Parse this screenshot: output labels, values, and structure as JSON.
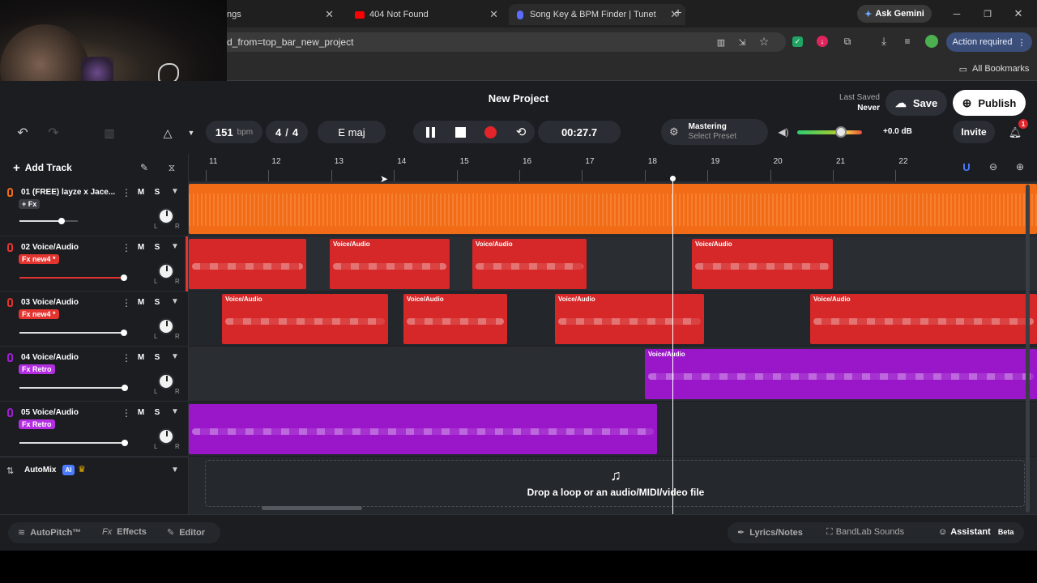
{
  "browser": {
    "tabs": [
      {
        "title": "ngs"
      },
      {
        "title": "404 Not Found"
      },
      {
        "title": "Song Key & BPM Finder | Tunet"
      }
    ],
    "ask_gemini": "Ask Gemini",
    "url": "d_from=top_bar_new_project",
    "action_required": "Action required",
    "all_bookmarks": "All Bookmarks"
  },
  "header": {
    "project_title": "New Project",
    "last_saved_label": "Last Saved",
    "last_saved_value": "Never",
    "save_label": "Save",
    "publish_label": "Publish",
    "bpm_value": "151",
    "bpm_unit": "bpm",
    "time_sig_num": "4",
    "time_sig_den": "4",
    "key": "E maj",
    "time_display": "00:27.7",
    "mastering_label": "Mastering",
    "mastering_preset": "Select Preset",
    "db_value": "+0.0 dB",
    "invite_label": "Invite",
    "notification_count": "1",
    "master_volume": 0.68
  },
  "tracks_panel": {
    "add_track_label": "Add Track",
    "automix_label": "AutoMix",
    "ai_badge": "AI"
  },
  "tracks": [
    {
      "name": "01  (FREE) layze x Jace...",
      "fx": "+ Fx",
      "fx_color": "#3a3d44",
      "color": "#f26b16",
      "volume": 0.72
    },
    {
      "name": "02  Voice/Audio",
      "fx": "Fx new4 *",
      "fx_color": "#e3342f",
      "color": "#e3342f",
      "volume": 0.99
    },
    {
      "name": "03  Voice/Audio",
      "fx": "Fx new4 *",
      "fx_color": "#e3342f",
      "color": "#e3342f",
      "volume": 0.99
    },
    {
      "name": "04  Voice/Audio",
      "fx": "Fx Retro",
      "fx_color": "#b32ee0",
      "color": "#a21bd4",
      "volume": 1.0
    },
    {
      "name": "05  Voice/Audio",
      "fx": "Fx Retro",
      "fx_color": "#b32ee0",
      "color": "#a21bd4",
      "volume": 1.0
    }
  ],
  "track_buttons": {
    "mute": "M",
    "solo": "S",
    "pan_left": "L",
    "pan_right": "R"
  },
  "ruler": [
    "11",
    "12",
    "13",
    "14",
    "15",
    "16",
    "17",
    "18",
    "19",
    "20",
    "21",
    "22"
  ],
  "clip_label": "Voice/Audio",
  "drop_zone_text": "Drop a loop or an audio/MIDI/video file",
  "bottom_bar": {
    "autopitch": "AutoPitch™",
    "effects": "Effects",
    "editor": "Editor",
    "lyrics": "Lyrics/Notes",
    "sounds": "BandLab Sounds",
    "assistant": "Assistant",
    "beta": "Beta"
  },
  "colors": {
    "orange": "#f26b16",
    "red": "#e3342f",
    "purple": "#a21bd4",
    "accent_blue": "#4a7cff"
  }
}
